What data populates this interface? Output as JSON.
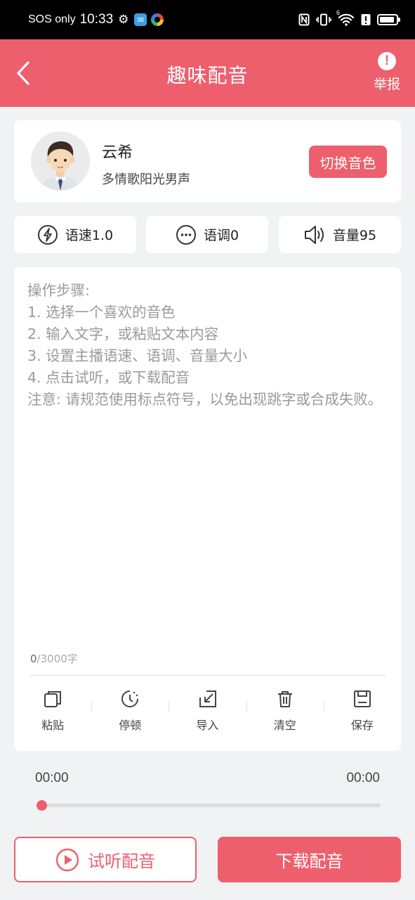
{
  "status_bar": {
    "carrier": "SOS only",
    "time": "10:33",
    "icons": [
      "gear-icon",
      "app-icon",
      "app-icon",
      "nfc-icon",
      "vibrate-icon",
      "wifi-icon",
      "alert-icon",
      "battery-icon"
    ],
    "wifi_label": "6",
    "battery_level": 0.9
  },
  "app_bar": {
    "title": "趣味配音",
    "report_label": "举报"
  },
  "voice": {
    "name": "云希",
    "description": "多情歌阳光男声",
    "switch_label": "切换音色"
  },
  "params": {
    "speed": "语速1.0",
    "tone": "语调0",
    "volume": "音量95"
  },
  "editor": {
    "placeholder": "操作步骤:\n1. 选择一个喜欢的音色\n2. 输入文字，或粘贴文本内容\n3. 设置主播语速、语调、音量大小\n4. 点击试听，或下载配音\n注意: 请规范使用标点符号，以免出现跳字或合成失败。",
    "count": "0",
    "limit": "/3000字"
  },
  "tools": {
    "paste": "粘贴",
    "pause": "停顿",
    "import": "导入",
    "clear": "清空",
    "save": "保存"
  },
  "player": {
    "current_time": "00:00",
    "total_time": "00:00",
    "progress": 0
  },
  "actions": {
    "preview_label": "试听配音",
    "download_label": "下载配音"
  },
  "colors": {
    "accent": "#ee5f6d",
    "background": "#f1f2f4"
  }
}
